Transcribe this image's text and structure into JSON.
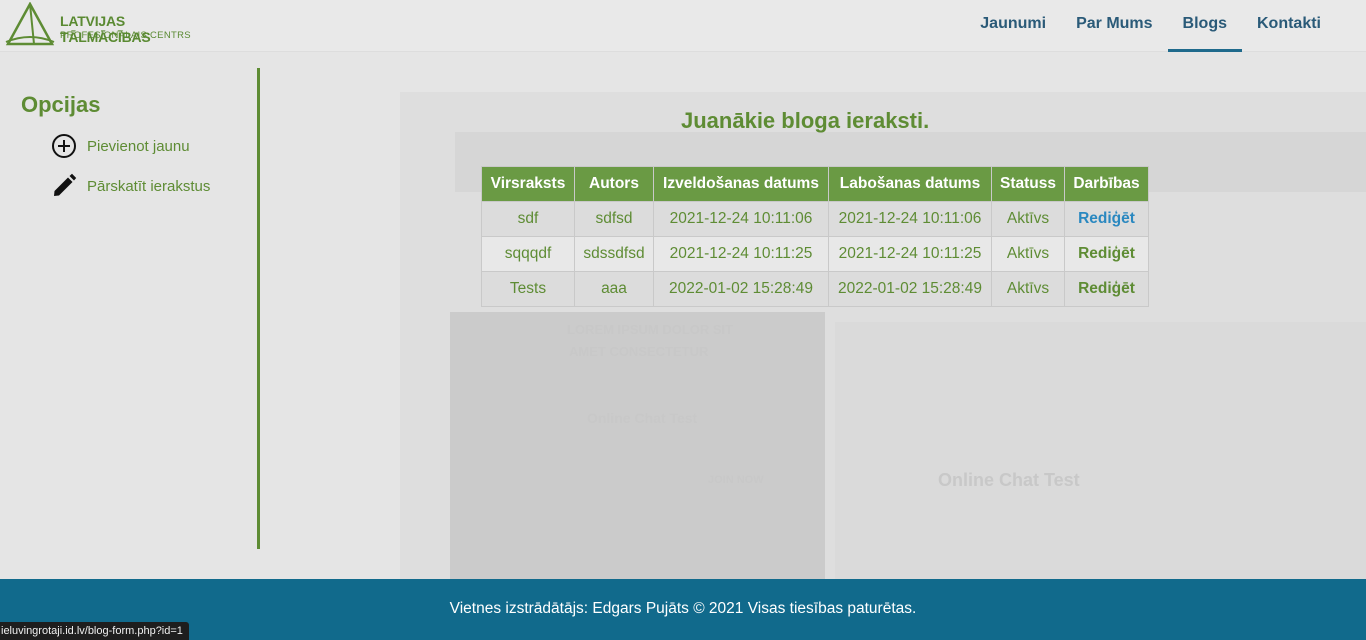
{
  "brand": {
    "title": "LATVIJAS TĀLMĀCĪBAS",
    "subtitle": "PROFESIONĀLAIS CENTRS",
    "accent_color": "#5e8c34"
  },
  "nav": {
    "items": [
      {
        "label": "Jaunumi"
      },
      {
        "label": "Par Mums"
      },
      {
        "label": "Blogs"
      },
      {
        "label": "Kontakti"
      }
    ],
    "active": "Blogs"
  },
  "sidebar": {
    "title": "Opcijas",
    "items": [
      {
        "label": "Pievienot jaunu",
        "icon": "plus-circle-icon"
      },
      {
        "label": "Pārskatīt ierakstus",
        "icon": "pencil-icon"
      }
    ]
  },
  "main": {
    "title": "Juanākie bloga ieraksti.",
    "table": {
      "headers": [
        "Virsraksts",
        "Autors",
        "Izveldošanas datums",
        "Labošanas datums",
        "Statuss",
        "Darbības"
      ],
      "rows": [
        {
          "title": "sdf",
          "author": "sdfsd",
          "created": "2021-12-24 10:11:06",
          "modified": "2021-12-24 10:11:06",
          "status": "Aktīvs",
          "action": "Rediģēt"
        },
        {
          "title": "sqqqdf",
          "author": "sdssdfsd",
          "created": "2021-12-24 10:11:25",
          "modified": "2021-12-24 10:11:25",
          "status": "Aktīvs",
          "action": "Rediģēt"
        },
        {
          "title": "Tests",
          "author": "aaa",
          "created": "2022-01-02 15:28:49",
          "modified": "2022-01-02 15:28:49",
          "status": "Aktīvs",
          "action": "Rediģēt"
        }
      ]
    }
  },
  "footer": {
    "text": "Vietnes izstrādātājs: Edgars Pujāts © 2021 Visas tiesības paturētas."
  },
  "statusbar": {
    "url": "ieluvingrotaji.id.lv/blog-form.php?id=1"
  },
  "background": {
    "texts": [
      "LOREM IPSUM DOLOR SIT",
      "AMET CONSECTETUR",
      "Online Chat Test",
      "Online Chat Test",
      "JOIN NOW"
    ]
  }
}
